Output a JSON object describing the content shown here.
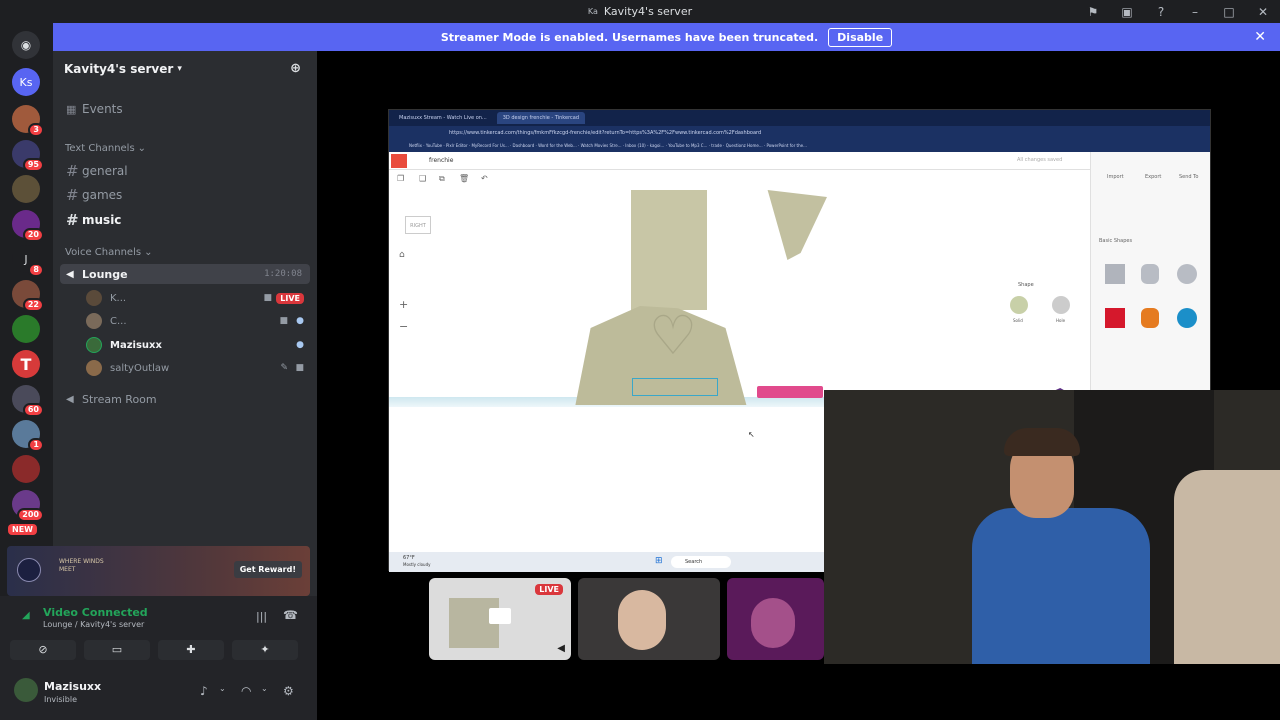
{
  "app": {
    "window_title": "Kavity4's server",
    "title_avatar_initials": "Ka",
    "titlebar_icons": [
      "inbox-icon",
      "screen-share-icon",
      "help-icon",
      "minimize-icon",
      "maximize-icon",
      "close-icon"
    ]
  },
  "banner": {
    "message": "Streamer Mode is enabled. Usernames have been truncated.",
    "disable_label": "Disable",
    "accent": "#5865f2"
  },
  "guilds": {
    "ks_initials": "Ks",
    "badges": [
      "3",
      "95",
      "20",
      "8",
      "22",
      "60",
      "1",
      "200"
    ],
    "new_label": "NEW",
    "j_initial": "J"
  },
  "server": {
    "name": "Kavity4's server",
    "events_label": "Events",
    "text_category": "Text Channels",
    "text_channels": [
      "general",
      "games",
      "music"
    ],
    "voice_category": "Voice Channels",
    "voice_channel": "Lounge",
    "voice_timer": "1:20:08",
    "members": [
      {
        "name": "K...",
        "live": "LIVE"
      },
      {
        "name": "C..."
      },
      {
        "name": "Mazisuxx"
      },
      {
        "name": "saltyOutlaw"
      }
    ],
    "stream_room": "Stream Room"
  },
  "promo": {
    "brand_text": "WHERE WINDS MEET",
    "button": "Get Reward!"
  },
  "voice_panel": {
    "status": "Video Connected",
    "location": "Lounge / Kavity4's server",
    "user_name": "Mazisuxx",
    "user_status": "Invisible"
  },
  "stream": {
    "browser_tab_1": "Mazisuxx Stream - Watch Live on...",
    "browser_tab_2": "3D design frenchie - Tinkercad",
    "url": "https://www.tinkercad.com/things/fmkmFfkzcgd-frenchie/edit?returnTo=https%3A%2F%2Fwww.tinkercad.com%2Fdashboard",
    "bookmarks": [
      "Netflix",
      "YouTube",
      "Pixlr Editor",
      "MyRecord For Us...",
      "Dashboard",
      "Word for the Web...",
      "Watch Movies Stre...",
      "Inbox (10) - kagoi...",
      "YouTube to Mp3 C...",
      "trade",
      "Questionz Home...",
      "PowerPoint for the..."
    ],
    "design_name": "frenchie",
    "save_status": "All changes saved",
    "right_buttons": [
      "Import",
      "Export",
      "Send To"
    ],
    "shape_panel_title": "Shape",
    "shape_solid": "Solid",
    "shape_hole": "Hole",
    "basic_shapes": "Basic Shapes",
    "view_cube": "RIGHT",
    "taskbar_weather_temp": "67°F",
    "taskbar_weather": "Mostly cloudy",
    "taskbar_search": "Search",
    "live_label": "LIVE"
  }
}
